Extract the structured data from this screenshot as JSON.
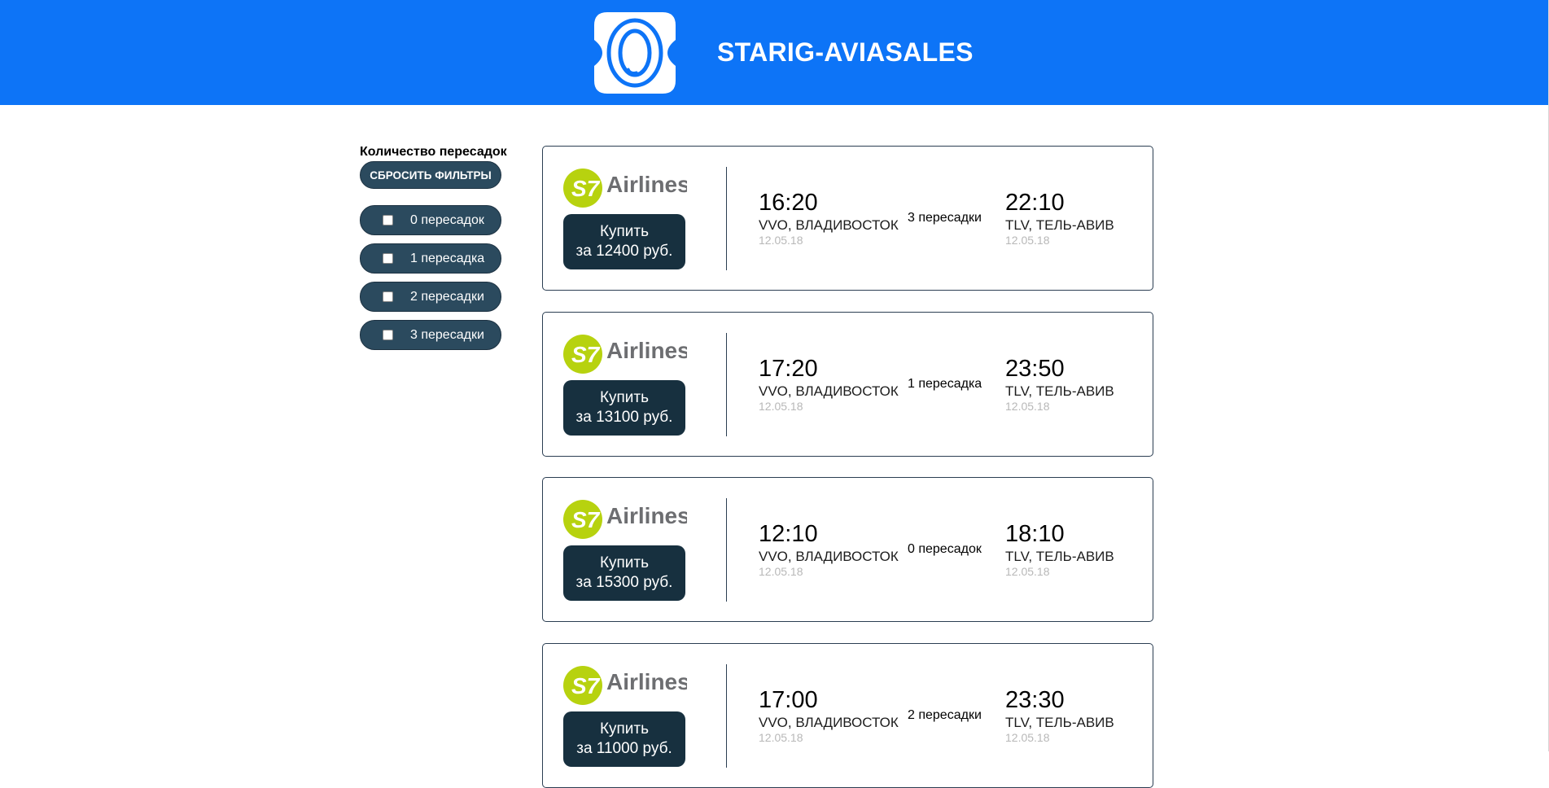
{
  "app": {
    "title": "STARIG-AVIASALES"
  },
  "filters": {
    "title": "Количество пересадок",
    "reset_label": "СБРОСИТЬ ФИЛЬТРЫ",
    "options": [
      {
        "label": "0 пересадок",
        "checked": false
      },
      {
        "label": "1 пересадка",
        "checked": false
      },
      {
        "label": "2 пересадки",
        "checked": false
      },
      {
        "label": "3 пересадки",
        "checked": false
      }
    ]
  },
  "tickets": [
    {
      "airline": "S7 Airlines",
      "buy_line1": "Купить",
      "buy_line2": "за 12400 руб.",
      "departure_time": "16:20",
      "origin": "VVO, ВЛАДИВОСТОК",
      "departure_date": "12.05.18",
      "stops": "3 пересадки",
      "arrival_time": "22:10",
      "destination": "TLV, ТЕЛЬ-АВИВ",
      "arrival_date": "12.05.18"
    },
    {
      "airline": "S7 Airlines",
      "buy_line1": "Купить",
      "buy_line2": "за 13100 руб.",
      "departure_time": "17:20",
      "origin": "VVO, ВЛАДИВОСТОК",
      "departure_date": "12.05.18",
      "stops": "1 пересадка",
      "arrival_time": "23:50",
      "destination": "TLV, ТЕЛЬ-АВИВ",
      "arrival_date": "12.05.18"
    },
    {
      "airline": "S7 Airlines",
      "buy_line1": "Купить",
      "buy_line2": "за 15300 руб.",
      "departure_time": "12:10",
      "origin": "VVO, ВЛАДИВОСТОК",
      "departure_date": "12.05.18",
      "stops": "0 пересадок",
      "arrival_time": "18:10",
      "destination": "TLV, ТЕЛЬ-АВИВ",
      "arrival_date": "12.05.18"
    },
    {
      "airline": "S7 Airlines",
      "buy_line1": "Купить",
      "buy_line2": "за 11000 руб.",
      "departure_time": "17:00",
      "origin": "VVO, ВЛАДИВОСТОК",
      "departure_date": "12.05.18",
      "stops": "2 пересадки",
      "arrival_time": "23:30",
      "destination": "TLV, ТЕЛЬ-АВИВ",
      "arrival_date": "12.05.18"
    }
  ],
  "colors": {
    "header": "#0d74f7",
    "button": "#17303f",
    "filter": "#2b4a5e",
    "s7_green": "#b7d20f"
  }
}
